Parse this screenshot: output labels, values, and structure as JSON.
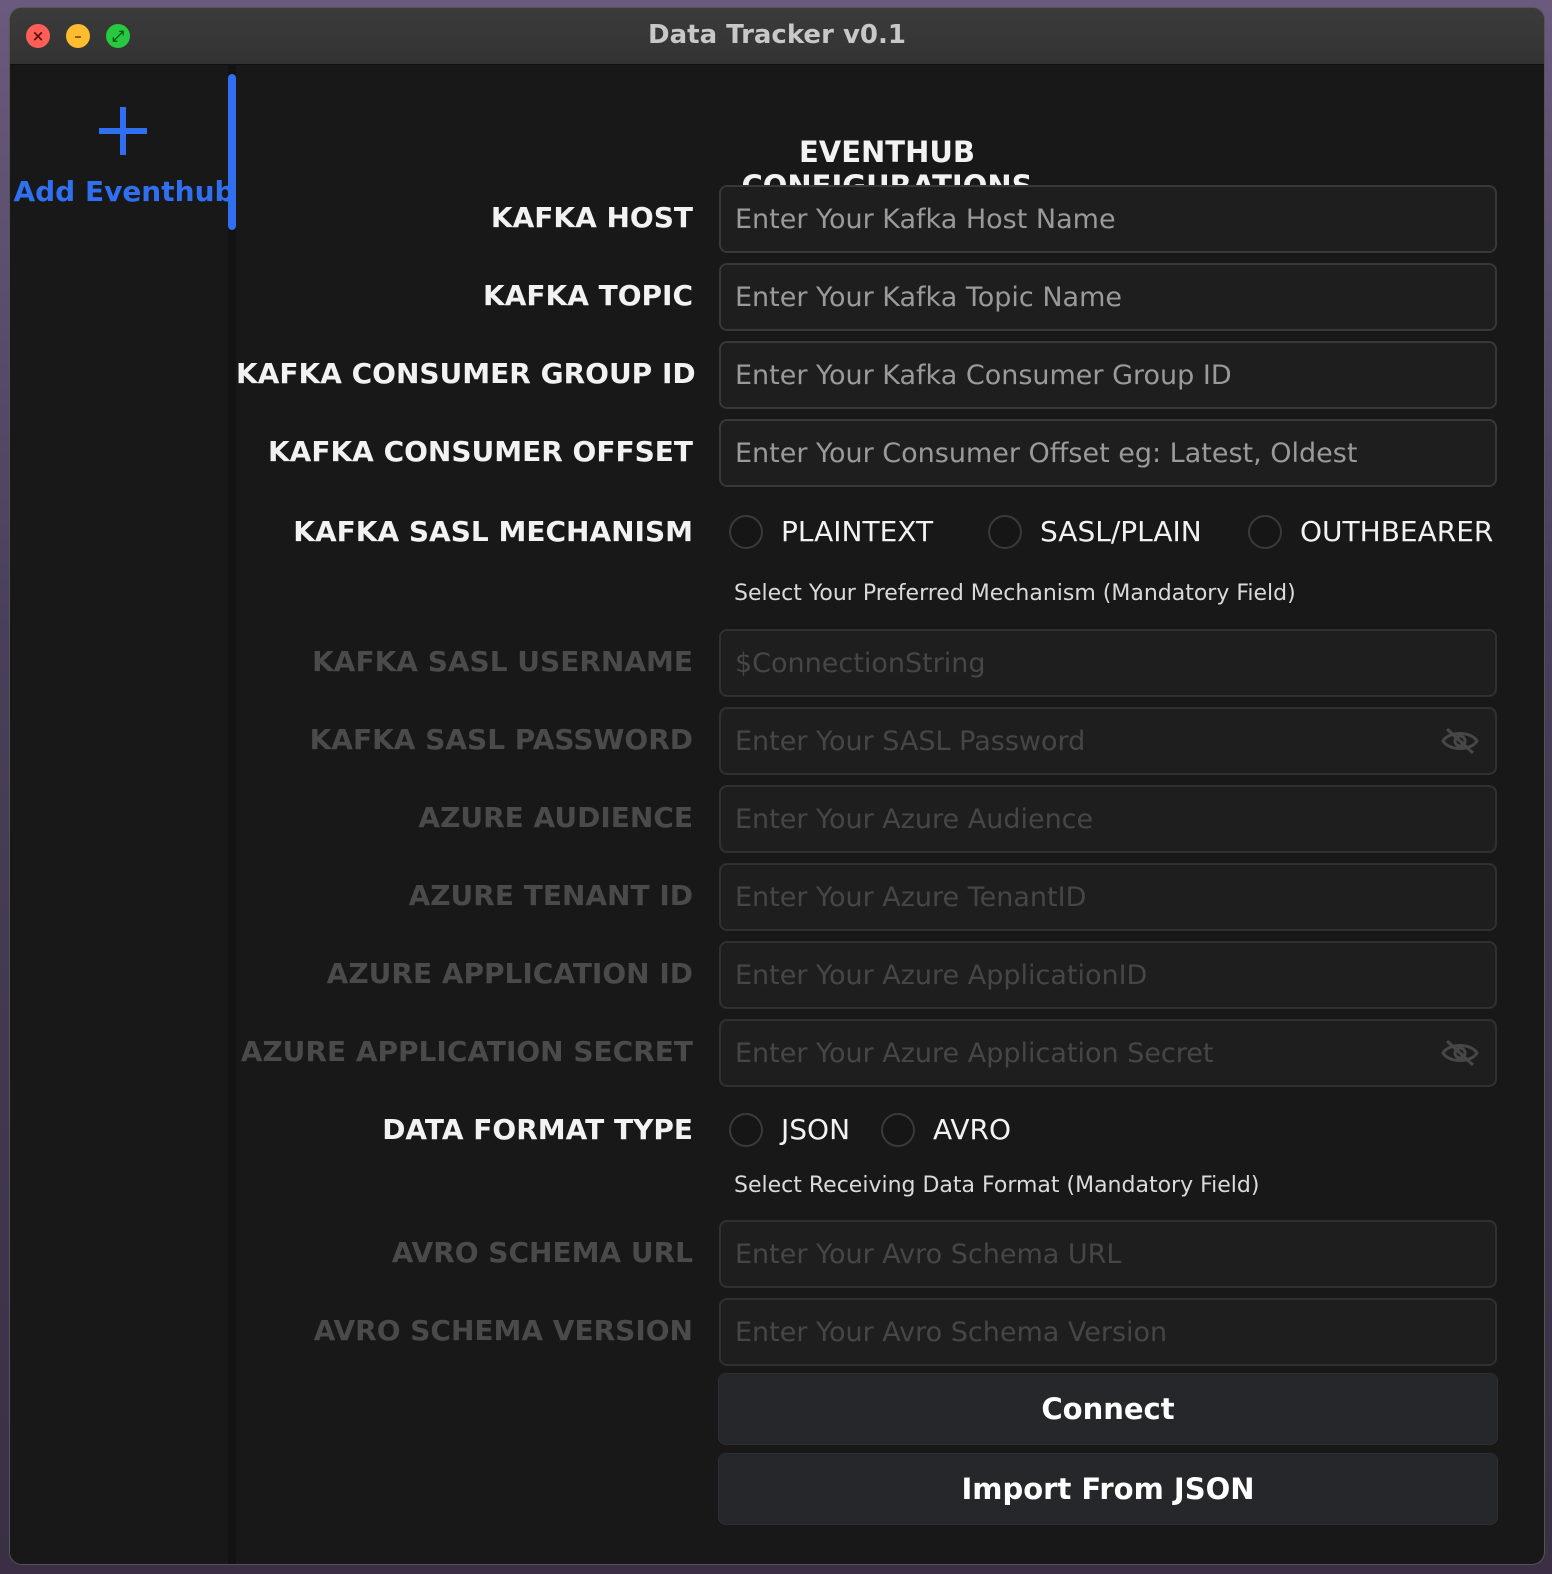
{
  "window": {
    "title": "Data Tracker v0.1"
  },
  "sidebar": {
    "add_label": "Add Eventhub"
  },
  "form": {
    "heading": "EVENTHUB CONFIGURATIONS",
    "kafka_host": {
      "label": "KAFKA HOST",
      "placeholder": "Enter Your Kafka Host Name",
      "value": ""
    },
    "kafka_topic": {
      "label": "KAFKA TOPIC",
      "placeholder": "Enter Your Kafka Topic Name",
      "value": ""
    },
    "consumer_group": {
      "label": "KAFKA CONSUMER GROUP ID",
      "placeholder": "Enter Your Kafka Consumer Group ID",
      "value": ""
    },
    "consumer_offset": {
      "label": "KAFKA CONSUMER OFFSET",
      "placeholder": "Enter Your Consumer Offset eg: Latest, Oldest",
      "value": ""
    },
    "sasl_mechanism": {
      "label": "KAFKA SASL MECHANISM",
      "options": [
        "PLAINTEXT",
        "SASL/PLAIN",
        "OUTHBEARER"
      ],
      "hint": "Select Your Preferred Mechanism (Mandatory Field)"
    },
    "sasl_username": {
      "label": "KAFKA SASL USERNAME",
      "placeholder": "$ConnectionString",
      "value": ""
    },
    "sasl_password": {
      "label": "KAFKA SASL PASSWORD",
      "placeholder": "Enter Your SASL Password",
      "value": ""
    },
    "azure_audience": {
      "label": "AZURE AUDIENCE",
      "placeholder": "Enter Your Azure Audience",
      "value": ""
    },
    "azure_tenant": {
      "label": "AZURE TENANT ID",
      "placeholder": "Enter Your Azure TenantID",
      "value": ""
    },
    "azure_app_id": {
      "label": "AZURE APPLICATION ID",
      "placeholder": "Enter Your Azure ApplicationID",
      "value": ""
    },
    "azure_app_secret": {
      "label": "AZURE APPLICATION SECRET",
      "placeholder": "Enter Your Azure Application Secret",
      "value": ""
    },
    "data_format": {
      "label": "DATA FORMAT TYPE",
      "options": [
        "JSON",
        "AVRO"
      ],
      "hint": "Select Receiving Data Format (Mandatory Field)"
    },
    "avro_url": {
      "label": "AVRO SCHEMA URL",
      "placeholder": "Enter Your Avro Schema URL",
      "value": ""
    },
    "avro_version": {
      "label": "AVRO SCHEMA VERSION",
      "placeholder": "Enter Your Avro Schema Version",
      "value": ""
    }
  },
  "buttons": {
    "connect": "Connect",
    "import_json": "Import From JSON"
  },
  "icons": {
    "password_toggle": "eye-slash-icon"
  },
  "colors": {
    "accent": "#2f6ff0",
    "background": "#181818",
    "button": "#26272b"
  }
}
